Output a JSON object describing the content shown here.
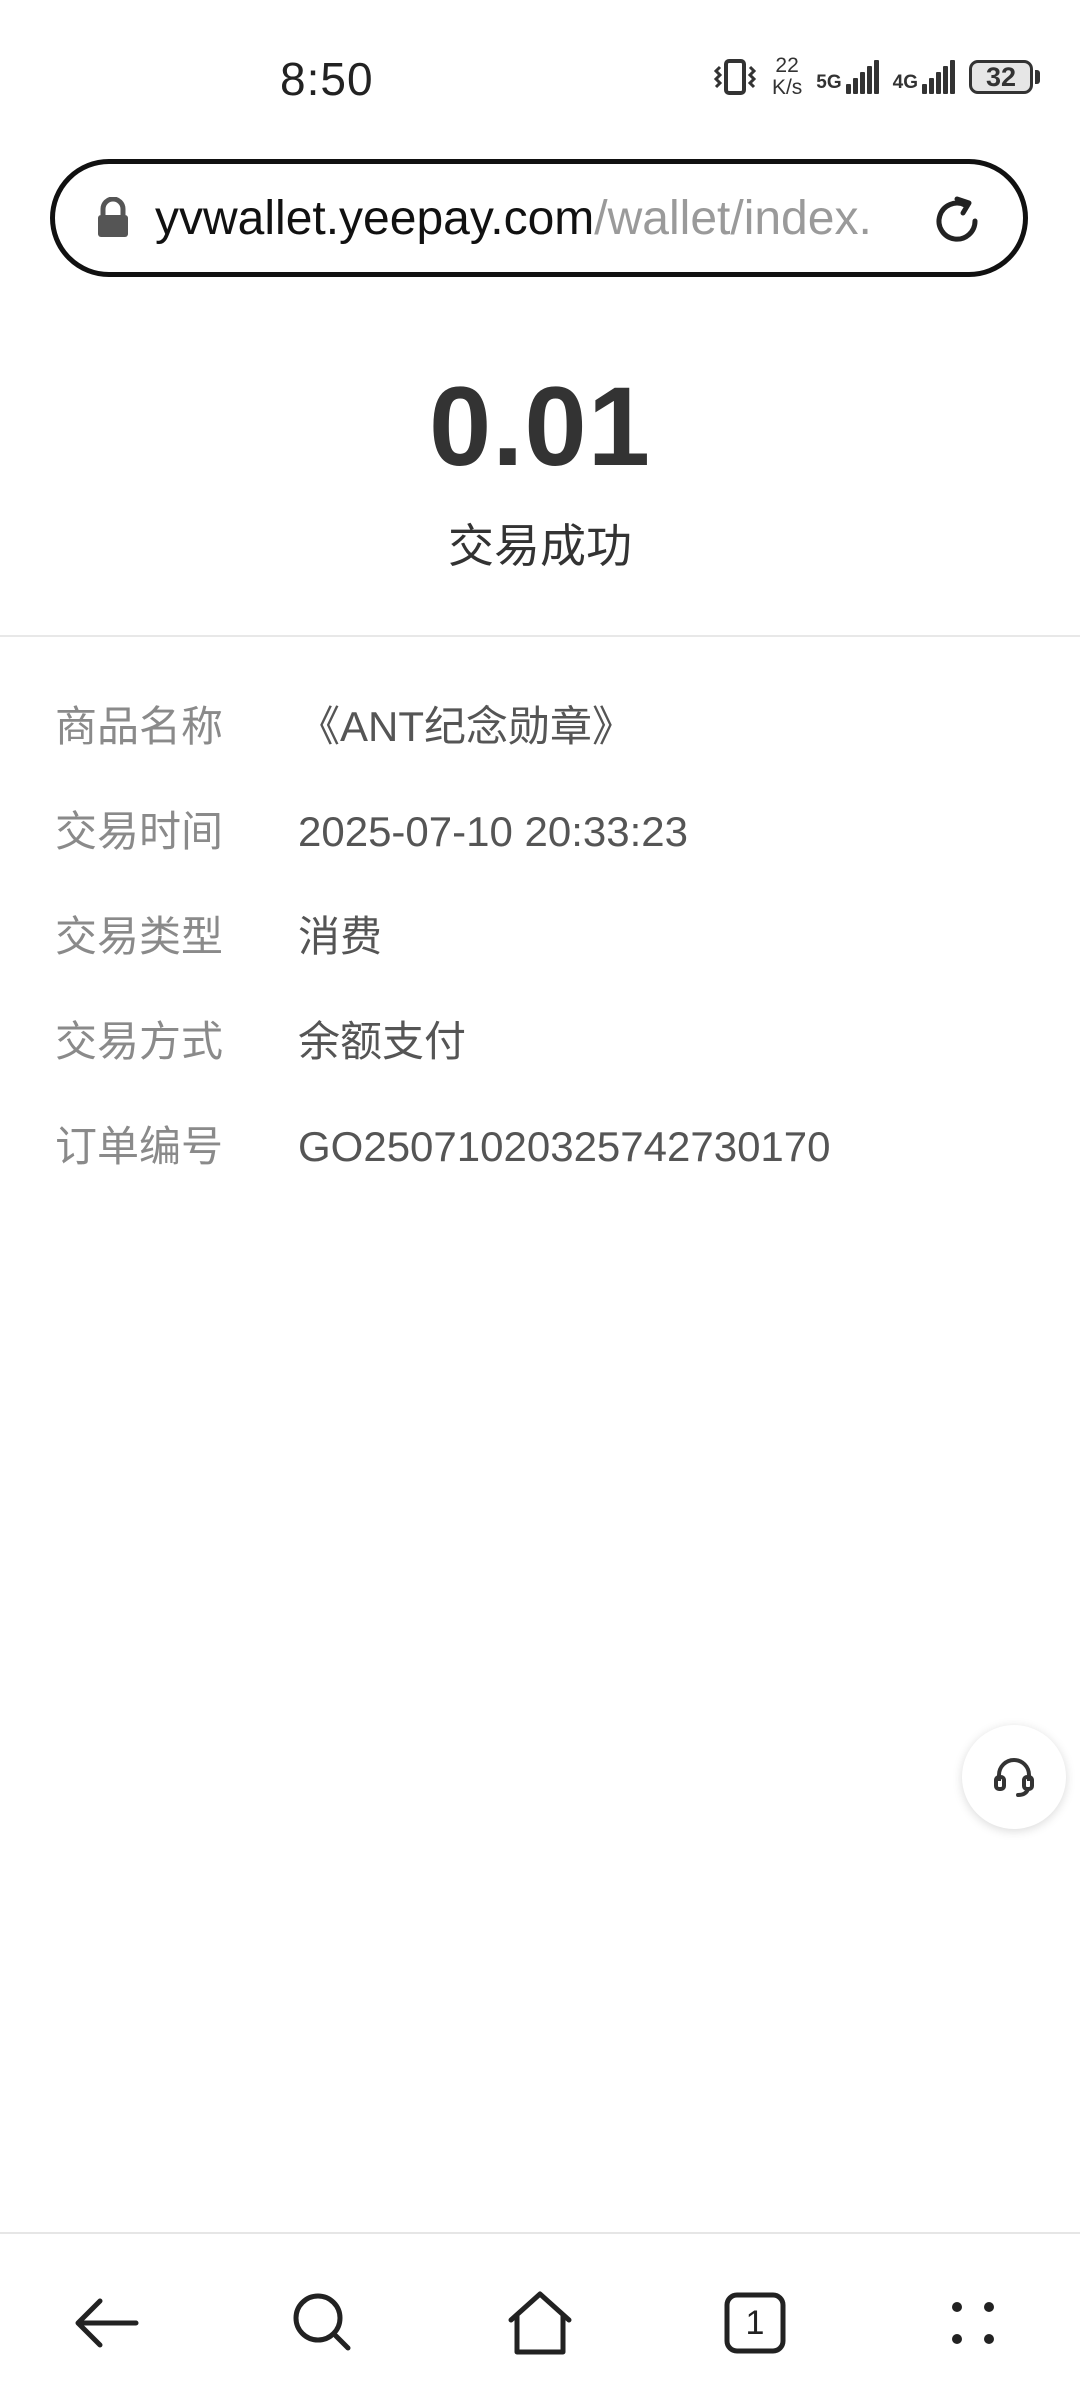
{
  "status_bar": {
    "time": "8:50",
    "net_speed_value": "22",
    "net_speed_unit": "K/s",
    "sim1_label": "5G",
    "sim2_label": "4G",
    "battery": "32",
    "icons": [
      "vibrate-icon",
      "signal-icon",
      "battery-icon"
    ]
  },
  "browser": {
    "url_host": "yvwallet.yeepay.com",
    "url_path": "/wallet/index.",
    "icons": [
      "lock-icon",
      "reload-icon"
    ]
  },
  "transaction": {
    "amount": "0.01",
    "status": "交易成功",
    "details": [
      {
        "label": "商品名称",
        "value": "《ANT纪念勋章》"
      },
      {
        "label": "交易时间",
        "value": "2025-07-10 20:33:23"
      },
      {
        "label": "交易类型",
        "value": "消费"
      },
      {
        "label": "交易方式",
        "value": "余额支付"
      },
      {
        "label": "订单编号",
        "value": "GO25071020325742730170"
      }
    ]
  },
  "floating": {
    "icon": "headset-icon"
  },
  "bottom_nav": {
    "tab_count": "1",
    "icons": [
      "back-arrow-icon",
      "search-icon",
      "home-icon",
      "tabs-icon",
      "more-icon"
    ]
  },
  "colors": {
    "label_text": "#8a8a8a",
    "value_text": "#555555",
    "amount_text": "#333333",
    "url_path": "#9a9a9a"
  }
}
